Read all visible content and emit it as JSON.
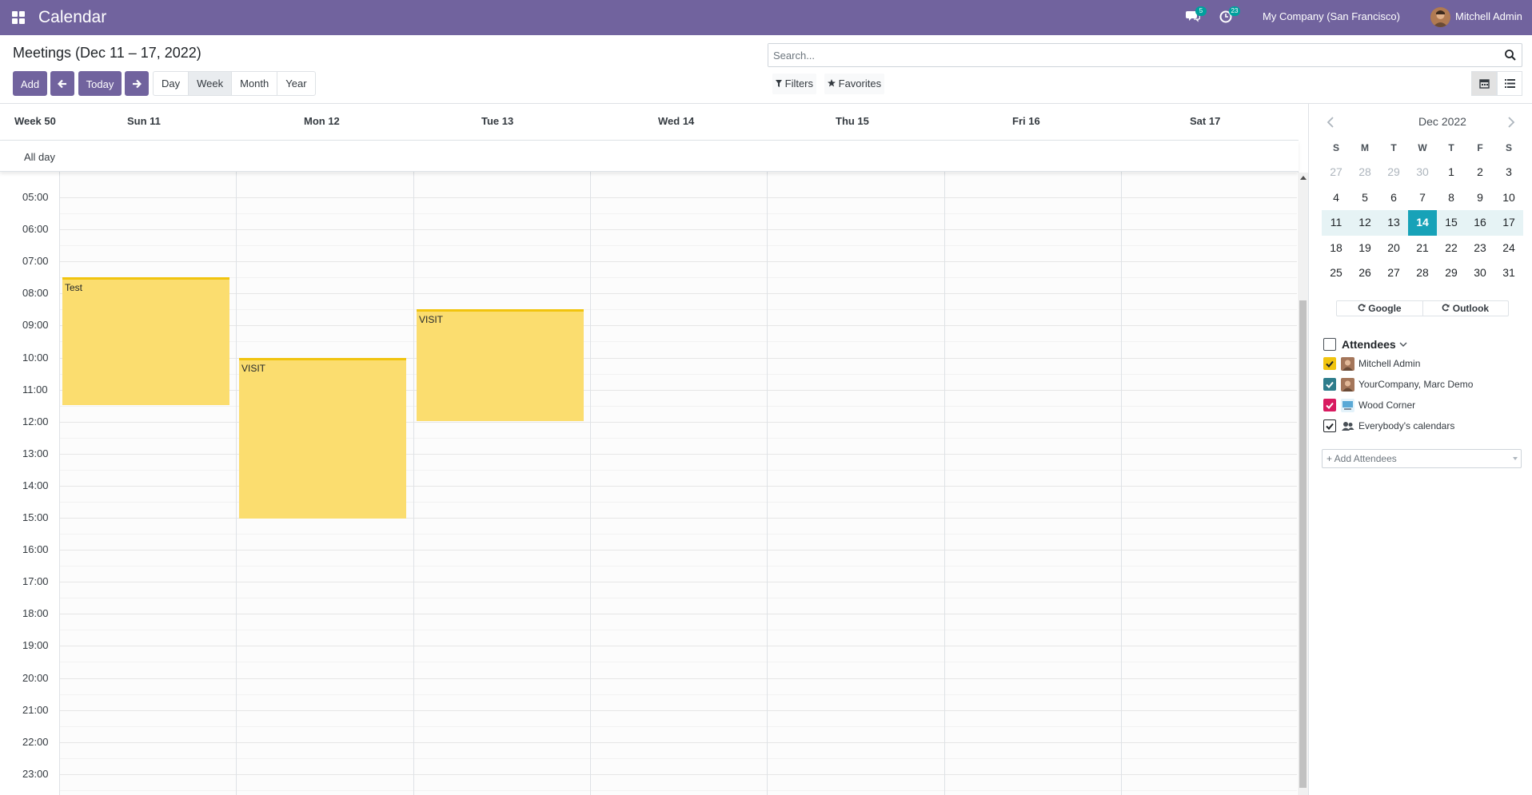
{
  "navbar": {
    "app_title": "Calendar",
    "messages_badge": "5",
    "activities_badge": "23",
    "company": "My Company (San Francisco)",
    "user": "Mitchell Admin",
    "bg_color": "#71639e"
  },
  "control_panel": {
    "title": "Meetings (Dec 11 – 17, 2022)",
    "add_label": "Add",
    "today_label": "Today",
    "scales": [
      "Day",
      "Week",
      "Month",
      "Year"
    ],
    "active_scale": "Week",
    "search_placeholder": "Search...",
    "filters_label": "Filters",
    "favorites_label": "Favorites"
  },
  "calendar": {
    "week_label": "Week 50",
    "days": [
      "Sun 11",
      "Mon 12",
      "Tue 13",
      "Wed 14",
      "Thu 15",
      "Fri 16",
      "Sat 17"
    ],
    "allday_label": "All day",
    "hours": [
      "05:00",
      "06:00",
      "07:00",
      "08:00",
      "09:00",
      "10:00",
      "11:00",
      "12:00",
      "13:00",
      "14:00",
      "15:00",
      "16:00",
      "17:00",
      "18:00",
      "19:00",
      "20:00",
      "21:00",
      "22:00",
      "23:00"
    ],
    "events": [
      {
        "title": "Test",
        "day": 0,
        "start": 7.5,
        "end": 11.5
      },
      {
        "title": "VISIT",
        "day": 1,
        "start": 10.0,
        "end": 15.0
      },
      {
        "title": "VISIT",
        "day": 2,
        "start": 8.5,
        "end": 12.0
      }
    ],
    "event_color": "#fbdd6f"
  },
  "sidebar": {
    "month_title": "Dec 2022",
    "weekday_headers": [
      "S",
      "M",
      "T",
      "W",
      "T",
      "F",
      "S"
    ],
    "weeks": [
      [
        "27",
        "28",
        "29",
        "30",
        "1",
        "2",
        "3"
      ],
      [
        "4",
        "5",
        "6",
        "7",
        "8",
        "9",
        "10"
      ],
      [
        "11",
        "12",
        "13",
        "14",
        "15",
        "16",
        "17"
      ],
      [
        "18",
        "19",
        "20",
        "21",
        "22",
        "23",
        "24"
      ],
      [
        "25",
        "26",
        "27",
        "28",
        "29",
        "30",
        "31"
      ]
    ],
    "today": "14",
    "google_label": "Google",
    "outlook_label": "Outlook",
    "attendees_title": "Attendees",
    "attendees": [
      {
        "name": "Mitchell Admin",
        "color": "#f1c40f",
        "icon": "avatar"
      },
      {
        "name": "YourCompany, Marc Demo",
        "color": "#2e7d8c",
        "icon": "avatar"
      },
      {
        "name": "Wood Corner",
        "color": "#d81b60",
        "icon": "company-logo"
      },
      {
        "name": "Everybody's calendars",
        "color": "#ffffff",
        "icon": "users-icon"
      }
    ],
    "add_attendees_placeholder": "+ Add Attendees"
  }
}
